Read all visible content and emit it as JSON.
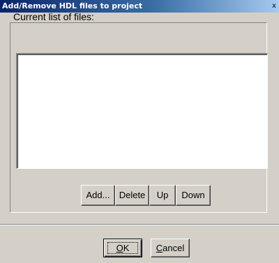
{
  "window": {
    "title": "Add/Remove HDL files to project",
    "close_glyph": "x"
  },
  "group": {
    "label": "Current list of files:"
  },
  "file_list": {
    "items": []
  },
  "list_buttons": {
    "add_label": "Add...",
    "delete_label": "Delete",
    "up_label": "Up",
    "down_label": "Down"
  },
  "footer": {
    "ok_mnemonic": "O",
    "ok_rest": "K",
    "cancel_mnemonic": "C",
    "cancel_rest": "ancel"
  }
}
